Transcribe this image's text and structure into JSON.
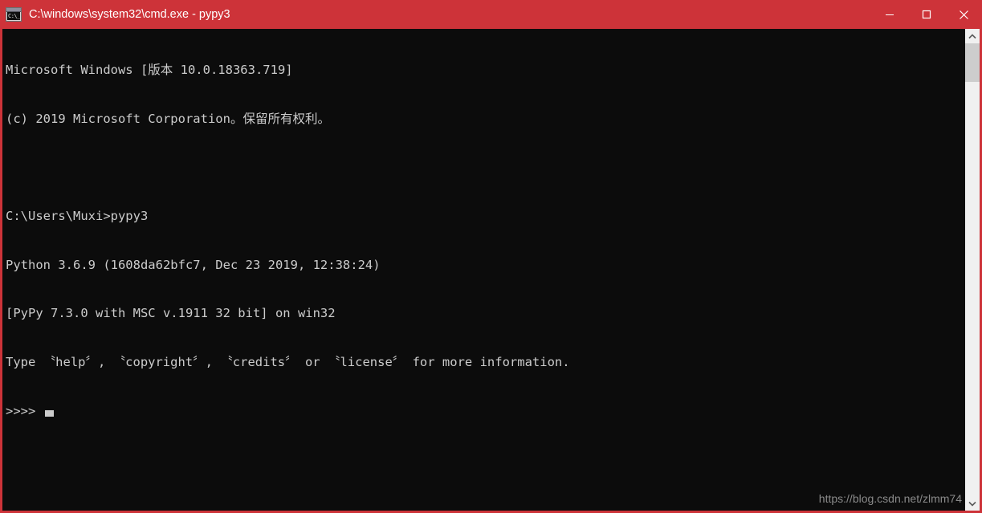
{
  "window": {
    "title": "C:\\windows\\system32\\cmd.exe - pypy3",
    "icon_name": "cmd-icon",
    "icon_glyph": "C:\\_",
    "accent_color": "#cd3339",
    "console_bg": "#0c0c0c",
    "console_fg": "#cccccc"
  },
  "controls": {
    "minimize_label": "Minimize",
    "maximize_label": "Maximize",
    "close_label": "Close"
  },
  "console": {
    "lines": [
      "Microsoft Windows [版本 10.0.18363.719]",
      "(c) 2019 Microsoft Corporation。保留所有权利。",
      "",
      "C:\\Users\\Muxi>pypy3",
      "Python 3.6.9 (1608da62bfc7, Dec 23 2019, 12:38:24)",
      "[PyPy 7.3.0 with MSC v.1911 32 bit] on win32",
      "Type 〝help〞, 〝copyright〞, 〝credits〞 or 〝license〞 for more information."
    ],
    "prompt": ">>>>",
    "cursor": "block-cursor"
  },
  "watermark": {
    "text": "https://blog.csdn.net/zlmm74"
  },
  "scrollbar": {
    "up_arrow": "chevron-up-icon",
    "down_arrow": "chevron-down-icon",
    "thumb": "scrollbar-thumb"
  }
}
